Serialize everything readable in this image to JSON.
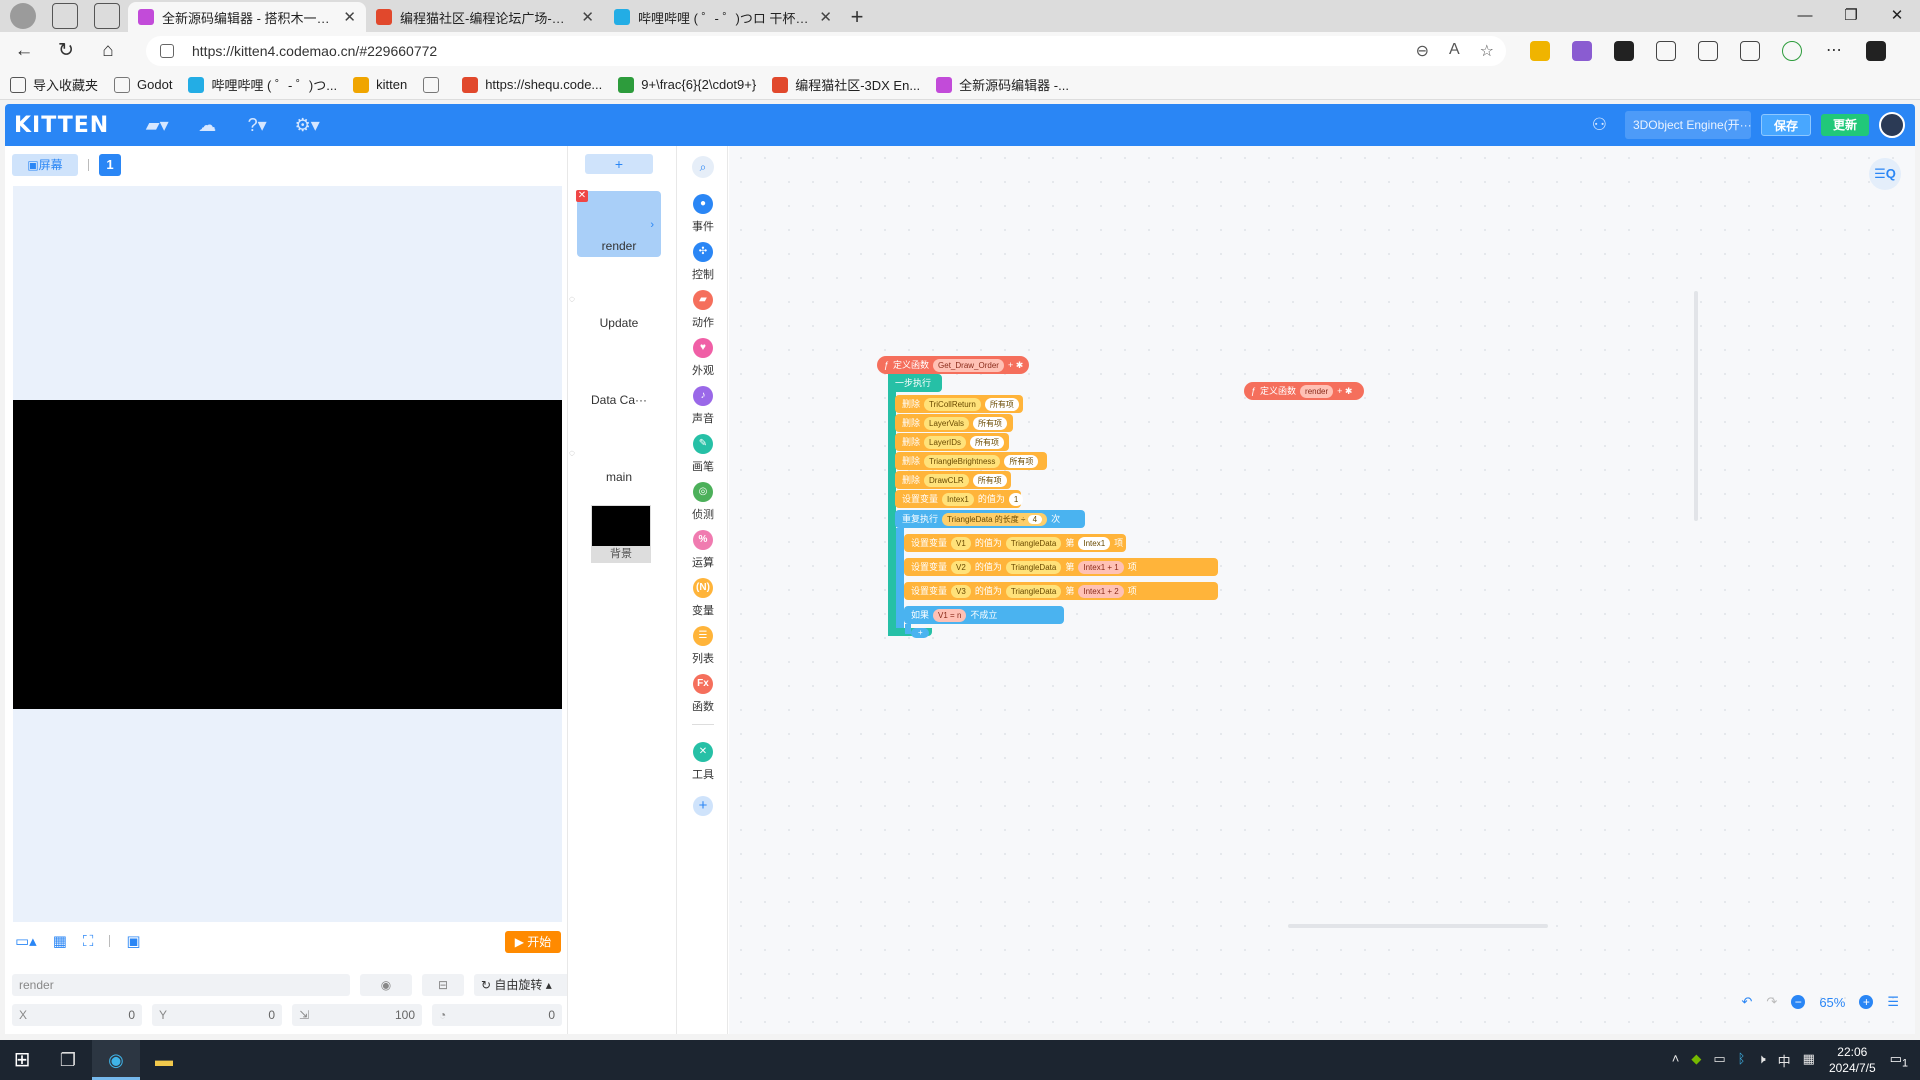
{
  "browser": {
    "tabs": [
      {
        "label": "全新源码编辑器 - 搭积木一样有趣",
        "color": "#c24bd9",
        "active": true
      },
      {
        "label": "编程猫社区-编程论坛广场-编程猫",
        "color": "#e1482c",
        "active": false
      },
      {
        "label": "哔哩哔哩 ( ゜- ゜)つロ 干杯~-bilibili",
        "color": "#23ade5",
        "active": false
      }
    ],
    "url": "https://kitten4.codemao.cn/#229660772",
    "bookmarks": [
      {
        "label": "导入收藏夹",
        "color": "#555555"
      },
      {
        "label": "Godot",
        "color": "#777777"
      },
      {
        "label": "哔哩哔哩 ( ゜- ゜)つ...",
        "color": "#23ade5"
      },
      {
        "label": "kitten",
        "color": "#f0a500"
      },
      {
        "label": "",
        "color": "#777777"
      },
      {
        "label": "https://shequ.code...",
        "color": "#e1482c"
      },
      {
        "label": "9+\\frac{6}{2\\cdot9+}",
        "color": "#2d9c3c"
      },
      {
        "label": "编程猫社区-3DX En...",
        "color": "#e1482c"
      },
      {
        "label": "全新源码编辑器 -...",
        "color": "#c24bd9"
      }
    ]
  },
  "kitten": {
    "logo": "KITTEN",
    "project_name": "3DObject Engine(开···",
    "save_label": "保存",
    "update_label": "更新"
  },
  "stage": {
    "screen_label": "屏幕",
    "screen_number": "1",
    "start_label": "开始",
    "sprite_name_value": "render",
    "rotation_label": "自由旋转",
    "x_label": "X",
    "x_value": "0",
    "y_label": "Y",
    "y_value": "0",
    "size_value": "100",
    "direction_value": "0"
  },
  "sprites": {
    "add_label": "+",
    "items": [
      {
        "name": "render",
        "active": true
      },
      {
        "name": "Update",
        "active": false
      },
      {
        "name": "Data Ca···",
        "active": false
      },
      {
        "name": "main",
        "active": false
      }
    ],
    "background_label": "背景"
  },
  "categories": [
    {
      "label": "事件",
      "color": "#2a86f5",
      "icon": "event-icon"
    },
    {
      "label": "控制",
      "color": "#2a86f5",
      "icon": "control-icon"
    },
    {
      "label": "动作",
      "color": "#f56f5c",
      "icon": "motion-icon"
    },
    {
      "label": "外观",
      "color": "#f05fa6",
      "icon": "looks-icon"
    },
    {
      "label": "声音",
      "color": "#9a68e8",
      "icon": "sound-icon"
    },
    {
      "label": "画笔",
      "color": "#26c0a6",
      "icon": "pen-icon"
    },
    {
      "label": "侦测",
      "color": "#4cb05a",
      "icon": "sensing-icon"
    },
    {
      "label": "运算",
      "color": "#f07bb0",
      "icon": "operator-icon"
    },
    {
      "label": "变量",
      "color": "#ffb43a",
      "icon": "variable-icon"
    },
    {
      "label": "列表",
      "color": "#ffb43a",
      "icon": "list-icon"
    },
    {
      "label": "函数",
      "color": "#f56f5c",
      "icon": "function-icon"
    },
    {
      "label": "工具",
      "color": "#26c0a6",
      "icon": "tools-icon"
    }
  ],
  "blocks": {
    "def_label": "定义函数",
    "func1_name": "Get_Draw_Order",
    "func2_name": "render",
    "step_label": "一步执行",
    "delete_all": "删除",
    "all_items": "所有项",
    "lists": [
      "TriCollReturn",
      "LayerVals",
      "LayerIDs",
      "TriangleBrightness",
      "DrawCLR"
    ],
    "set_var": "设置变量",
    "value_as": "的值为",
    "intex1": "Intex1",
    "one": "1",
    "repeat_label": "重复执行",
    "triangle_data": "TriangleData",
    "length_label": "的长度",
    "div": "÷",
    "four": "4",
    "times": "次",
    "v1": "V1",
    "v2": "V2",
    "v3": "V3",
    "nth": "第",
    "item": "项",
    "plus": "+",
    "two": "2",
    "if_label": "如果",
    "eq": "=",
    "n": "n",
    "holds": "不成立"
  },
  "workspace": {
    "zoom": "65%"
  },
  "taskbar": {
    "time": "22:06",
    "date": "2024/7/5",
    "ime": "中",
    "notif_count": "1"
  }
}
